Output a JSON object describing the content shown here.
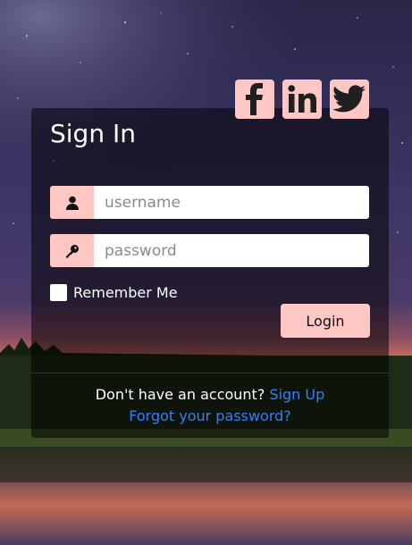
{
  "login": {
    "title": "Sign In",
    "username_placeholder": "username",
    "password_placeholder": "password",
    "remember_label": "Remember Me",
    "login_label": "Login",
    "no_account_text": "Don't have an account?",
    "signup_link": "Sign Up",
    "forgot_link": "Forgot your password?"
  },
  "social": [
    {
      "name": "facebook",
      "icon": "facebook-icon"
    },
    {
      "name": "linkedin",
      "icon": "linkedin-icon"
    },
    {
      "name": "twitter",
      "icon": "twitter-icon"
    }
  ],
  "colors": {
    "accent": "#ffc7c4",
    "link": "#2f80ff",
    "card_overlay": "rgba(0,0,0,0.52)"
  }
}
